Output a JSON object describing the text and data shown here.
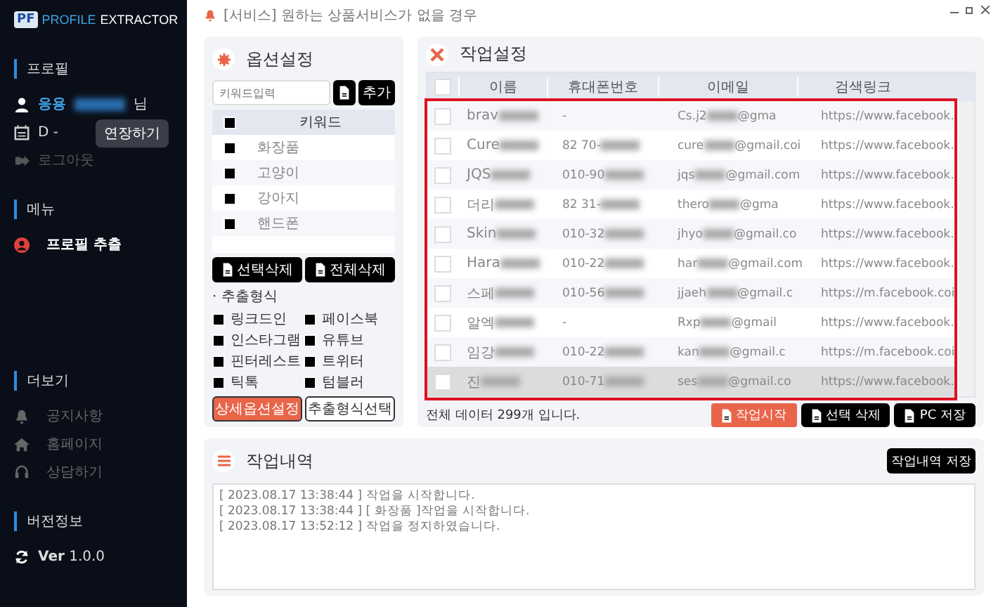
{
  "app": {
    "logo": "PF",
    "title_a": "PROFILE",
    "title_b": "EXTRACTOR"
  },
  "sidebar": {
    "sections": [
      {
        "title": "프로필",
        "items": [
          {
            "kind": "user",
            "label": "응용",
            "suffix": "님"
          },
          {
            "kind": "date",
            "label": "D -",
            "tooltip": "연장하기"
          },
          {
            "kind": "logout",
            "label": "로그아웃"
          }
        ]
      },
      {
        "title": "메뉴",
        "items": [
          {
            "kind": "menu",
            "label": "프로필 추출",
            "selected": true
          }
        ]
      },
      {
        "title": "더보기",
        "items": [
          {
            "kind": "notice",
            "label": "공지사항"
          },
          {
            "kind": "home",
            "label": "홈페이지"
          },
          {
            "kind": "support",
            "label": "상담하기"
          }
        ]
      },
      {
        "title": "버전정보",
        "items": [
          {
            "kind": "version",
            "label": "**Ver** 1.0.0"
          }
        ]
      }
    ]
  },
  "notice": "[서비스] 원하는 상품서비스가 없을 경우",
  "options": {
    "title": "옵션설정",
    "search": {
      "placeholder": "키워드입력"
    },
    "add_button": "추가",
    "keyword_header": "키워드",
    "all_checked": false,
    "keywords": [
      {
        "label": "화장품",
        "checked": false
      },
      {
        "label": "고양이",
        "checked": false
      },
      {
        "label": "강아지",
        "checked": false
      },
      {
        "label": "핸드폰",
        "checked": false
      }
    ],
    "delete_buttons": [
      "선택삭제",
      "전체삭제"
    ],
    "format_title": "· 추출형식",
    "formats": [
      {
        "label": "링크드인",
        "checked": false
      },
      {
        "label": "페이스북",
        "checked": false
      },
      {
        "label": "인스타그램",
        "checked": false
      },
      {
        "label": "유튜브",
        "checked": false
      },
      {
        "label": "핀터레스트",
        "checked": false
      },
      {
        "label": "트위터",
        "checked": false
      },
      {
        "label": "틱톡",
        "checked": false
      },
      {
        "label": "텀블러",
        "checked": false
      }
    ],
    "detail_button": "상세옵션설정",
    "format_button": "추출형식선택"
  },
  "work": {
    "title": "작업설정",
    "columns": [
      "이름",
      "휴대폰번호",
      "이메일",
      "검색링크"
    ],
    "all_checked": false,
    "rows": [
      {
        "name": "brav",
        "phone": "-",
        "email_a": "Cs.j2",
        "email_b": "@gma",
        "link": "https://www.facebook.",
        "selected": false
      },
      {
        "name": "Cure",
        "phone": "82 70-",
        "email_a": "cure",
        "email_b": "@gmail.coi",
        "link": "https://www.facebook.",
        "selected": false
      },
      {
        "name": "JQS",
        "phone": "010-90",
        "email_a": "jqs",
        "email_b": "@gmail.com",
        "link": "https://www.facebook.",
        "selected": false
      },
      {
        "name": "더리",
        "phone": "82 31-",
        "email_a": "thero",
        "email_b": "@gma",
        "link": "https://www.facebook.",
        "selected": false
      },
      {
        "name": "Skin",
        "phone": "010-32",
        "email_a": "jhyo",
        "email_b": "@gmail.co",
        "link": "https://www.facebook.",
        "selected": false
      },
      {
        "name": "Hara",
        "phone": "010-22",
        "email_a": "har",
        "email_b": "@gmail.com",
        "link": "https://www.facebook.",
        "selected": false
      },
      {
        "name": "스페",
        "phone": "010-56",
        "email_a": "jjaeh",
        "email_b": "@gmail.c",
        "link": "https://m.facebook.coi",
        "selected": false
      },
      {
        "name": "알엑",
        "phone": "-",
        "email_a": "Rxp",
        "email_b": "@gmail",
        "link": "https://www.facebook.",
        "selected": false
      },
      {
        "name": "임강",
        "phone": "010-22",
        "email_a": "kan",
        "email_b": "@gmail.c",
        "link": "https://m.facebook.coi",
        "selected": false
      },
      {
        "name": "진",
        "phone": "010-71",
        "email_a": "ses",
        "email_b": "@gmail.co",
        "link": "https://www.facebook.",
        "selected": true
      }
    ],
    "total": "전체 데이터 299개 입니다.",
    "buttons": [
      {
        "kind": "primary",
        "label": "작업시작"
      },
      {
        "kind": "dark",
        "label": "선택 삭제"
      },
      {
        "kind": "dark",
        "label": "PC 저장"
      }
    ]
  },
  "log": {
    "title": "작업내역",
    "save_button": "작업내역 저장",
    "lines": [
      "[ 2023.08.17 13:38:44 ] 작업을 시작합니다.",
      "[ 2023.08.17 13:38:44 ] [ 화장품 ]작업을 시작합니다.",
      "[ 2023.08.17 13:52:12 ] 작업을 정지하였습니다."
    ]
  }
}
